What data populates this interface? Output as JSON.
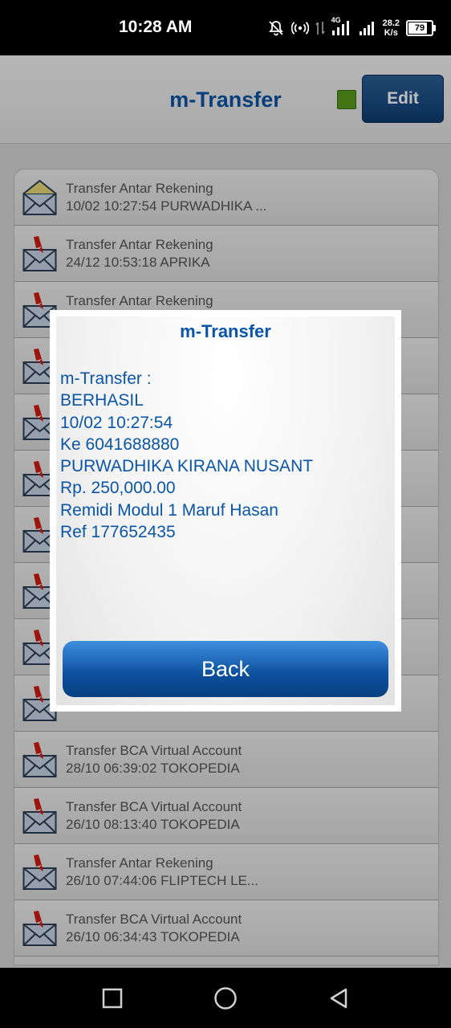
{
  "status_bar": {
    "time": "10:28 AM",
    "net_speed_value": "28.2",
    "net_speed_unit": "K/s",
    "battery": "79",
    "network_label": "4G"
  },
  "header": {
    "title": "m-Transfer",
    "edit_label": "Edit"
  },
  "list": {
    "items": [
      {
        "line1": "Transfer Antar Rekening",
        "line2": "10/02 10:27:54 PURWADHIKA ...",
        "read": true
      },
      {
        "line1": "Transfer Antar Rekening",
        "line2": "24/12 10:53:18 APRIKA",
        "read": false
      },
      {
        "line1": "Transfer Antar Rekening",
        "line2": "",
        "read": false
      },
      {
        "line1": "",
        "line2": "",
        "read": false
      },
      {
        "line1": "",
        "line2": "",
        "read": false
      },
      {
        "line1": "",
        "line2": "",
        "read": false
      },
      {
        "line1": "",
        "line2": "",
        "read": false
      },
      {
        "line1": "",
        "line2": "",
        "read": false
      },
      {
        "line1": "",
        "line2": "",
        "read": false
      },
      {
        "line1": "",
        "line2": "",
        "read": false
      },
      {
        "line1": "Transfer BCA Virtual Account",
        "line2": "28/10 06:39:02 TOKOPEDIA",
        "read": false
      },
      {
        "line1": "Transfer BCA Virtual Account",
        "line2": "26/10 08:13:40 TOKOPEDIA",
        "read": false
      },
      {
        "line1": "Transfer Antar Rekening",
        "line2": "26/10 07:44:06 FLIPTECH LE...",
        "read": false
      },
      {
        "line1": "Transfer BCA Virtual Account",
        "line2": "26/10 06:34:43 TOKOPEDIA",
        "read": false
      }
    ]
  },
  "dialog": {
    "title": "m-Transfer",
    "lines": [
      "m-Transfer :",
      "BERHASIL",
      "10/02 10:27:54",
      "Ke 6041688880",
      "PURWADHIKA KIRANA NUSANT",
      "Rp. 250,000.00",
      "Remidi Modul 1 Maruf Hasan",
      "Ref 177652435"
    ],
    "back_label": "Back"
  },
  "colors": {
    "brand_blue": "#0a55a6",
    "status_green": "#5a9d1c",
    "edit_button": "#1d4d85"
  },
  "icons": {
    "read_message": "open-envelope-icon",
    "unread_message": "envelope-with-red-flag-icon",
    "nav_recents": "square-icon",
    "nav_home": "circle-icon",
    "nav_back": "triangle-back-icon"
  }
}
